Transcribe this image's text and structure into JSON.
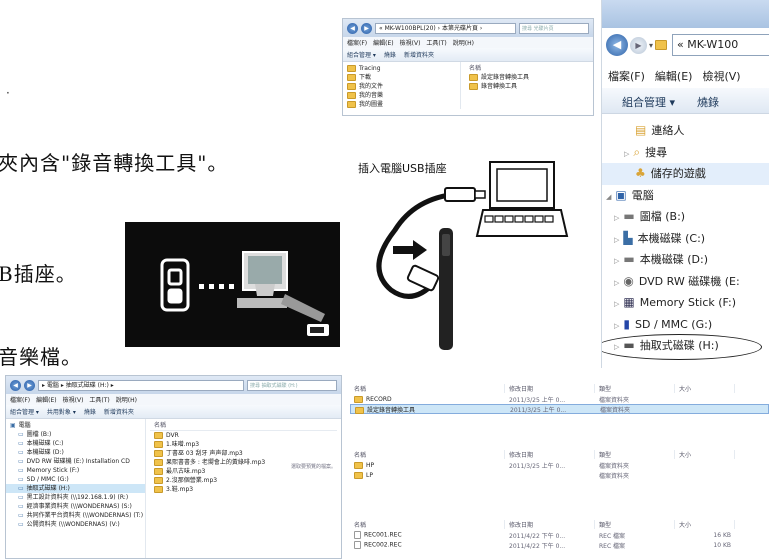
{
  "manual": {
    "line_folder": "夾內含\"錄音轉換工具\"。",
    "line_usb": "B插座。",
    "line_music": "音樂檔。",
    "usb_caption": "插入電腦USB插座"
  },
  "win_small": {
    "address": "« MK-W100BPL(20) › 本第光碟片頁 ›",
    "search": "搜尋 光碟片頁",
    "menu": [
      "檔案(F)",
      "編輯(E)",
      "檢視(V)",
      "工具(T)",
      "說明(H)"
    ],
    "toolbar": [
      "組合管理 ▾",
      "燒錄",
      "新增資料夾"
    ],
    "tree": [
      "Tracing",
      "下載",
      "我的文件",
      "我的音樂",
      "我的圖畫"
    ],
    "header_name": "名稱",
    "files": [
      "設定錄音轉換工具",
      "錄音轉換工具"
    ]
  },
  "win_zoom": {
    "address": "« MK-W100",
    "menu": [
      "檔案(F)",
      "編輯(E)",
      "檢視(V)"
    ],
    "toolbar": [
      "組合管理 ▾",
      "燒錄"
    ],
    "tree": [
      {
        "label": "連絡人",
        "icon": "contacts-icon"
      },
      {
        "label": "搜尋",
        "icon": "search-folder-icon"
      },
      {
        "label": "儲存的遊戲",
        "icon": "saved-games-icon"
      },
      {
        "label": "電腦",
        "icon": "computer-icon"
      },
      {
        "label": "圖檔 (B:)",
        "icon": "drive-icon"
      },
      {
        "label": "本機磁碟 (C:)",
        "icon": "system-drive-icon"
      },
      {
        "label": "本機磁碟 (D:)",
        "icon": "drive-icon"
      },
      {
        "label": "DVD RW 磁碟機 (E:",
        "icon": "dvd-icon"
      },
      {
        "label": "Memory Stick (F:)",
        "icon": "memory-stick-icon"
      },
      {
        "label": "SD / MMC (G:)",
        "icon": "sd-card-icon"
      },
      {
        "label": "抽取式磁碟 (H:)",
        "icon": "removable-drive-icon"
      }
    ]
  },
  "win_bottom": {
    "address": "▸ 電腦 ▸ 抽取式磁碟 (H:) ▸",
    "search": "搜尋 抽取式磁碟 (H:)",
    "menu": [
      "檔案(F)",
      "編輯(E)",
      "檢視(V)",
      "工具(T)",
      "說明(H)"
    ],
    "toolbar": [
      "組合管理 ▾",
      "共用對象 ▾",
      "燒錄",
      "新增資料夾"
    ],
    "tree": [
      "電腦",
      "圖檔 (B:)",
      "本機磁碟 (C:)",
      "本機磁碟 (D:)",
      "DVD RW 磁碟機 (E:) Installation CD",
      "Memory Stick (F:)",
      "SD / MMC (G:)",
      "抽取式磁碟 (H:)",
      "黑工設計資料夾 (\\\\192.168.1.9) (R:)",
      "經濟事業資料夾 (\\\\WONDERNAS) (S:)",
      "共同作業平台資料夾 (\\\\WONDERNAS) (T:)",
      "公開資料夾 (\\\\WONDERNAS) (V:)"
    ],
    "files_header": "名稱",
    "files": [
      "DVR",
      "1.味噌.mp3",
      "丁書巫 03 刮牙 声声部.mp3",
      "果熙書書多 : 老嚮會上的黃綠啡.mp3",
      "最爪古味.mp3",
      "2.沒那個營業.mp3",
      "3.鞋.mp3"
    ],
    "side_note": "選取要預覽的檔案。"
  },
  "list1": {
    "headers": [
      "名稱",
      "修改日期",
      "類型",
      "大小"
    ],
    "rows": [
      {
        "name": "RECORD",
        "date": "2011/3/25 上午 0...",
        "type": "檔案資料夾"
      },
      {
        "name": "設定錄音轉換工具",
        "date": "2011/3/25 上午 0...",
        "type": "檔案資料夾"
      }
    ]
  },
  "list2": {
    "headers": [
      "名稱",
      "修改日期",
      "類型",
      "大小"
    ],
    "rows": [
      {
        "name": "HP",
        "date": "2011/3/25 上午 0...",
        "type": "檔案資料夾"
      },
      {
        "name": "LP",
        "date": "",
        "type": "檔案資料夾"
      }
    ]
  },
  "list3": {
    "headers": [
      "名稱",
      "修改日期",
      "類型",
      "大小"
    ],
    "rows": [
      {
        "name": "REC001.REC",
        "date": "2011/4/22 下午 0...",
        "type": "REC 檔案",
        "size": "16 KB"
      },
      {
        "name": "REC002.REC",
        "date": "2011/4/22 下午 0...",
        "type": "REC 檔案",
        "size": "10 KB"
      }
    ]
  },
  "colors": {
    "accent": "#3b6ea5",
    "selected": "#cde6f7",
    "folder": "#f0c24a"
  }
}
